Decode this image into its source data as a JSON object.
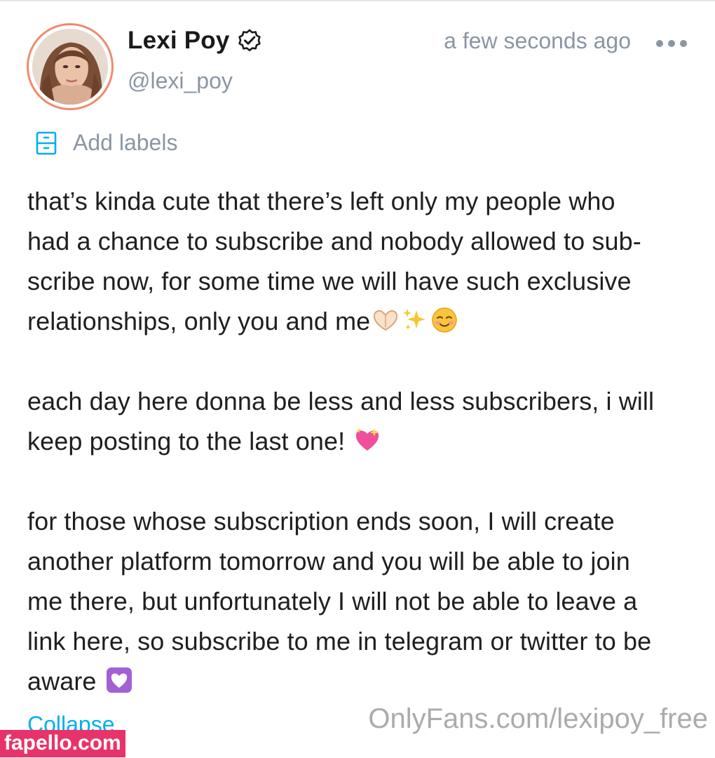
{
  "post": {
    "author": {
      "display_name": "Lexi Poy",
      "handle": "@lexi_poy",
      "verified": true,
      "avatar_icon": "avatar-photo"
    },
    "timestamp": "a few seconds ago",
    "more_icon": "more-dots-icon",
    "labels": {
      "icon": "label-icon",
      "text": "Add labels"
    },
    "paragraphs": [
      {
        "lines": [
          "that’s kinda cute that there’s left only my people who",
          "had a chance to subscribe and nobody allowed to sub-",
          "scribe now, for some time we will have such exclusive",
          "relationships, only you and me"
        ],
        "emojis": [
          "heart-hands-emoji",
          "sparkles-emoji",
          "smiling-face-emoji"
        ]
      },
      {
        "lines": [
          "each day here donna be less and less subscribers, i will",
          "keep posting to the last one!"
        ],
        "emojis": [
          "sparkling-heart-emoji"
        ]
      },
      {
        "lines": [
          "for those whose subscription ends soon, I will create",
          "another platform tomorrow and you will be able to join",
          "me there, but unfortunately I will not be able to leave a",
          "link here, so subscribe to me in telegram or twitter to be",
          "aware"
        ],
        "emojis": [
          "purple-heart-emoji"
        ]
      }
    ],
    "collapse_label": "Collapse"
  },
  "watermarks": {
    "onlyfans": "OnlyFans.com/lexipoy_free",
    "fapello": "fapello.com"
  },
  "colors": {
    "accent": "#00aff0",
    "muted": "#8a96a3",
    "avatar_ring": "#f08a6e",
    "fapello_bg": "#e8336a"
  }
}
